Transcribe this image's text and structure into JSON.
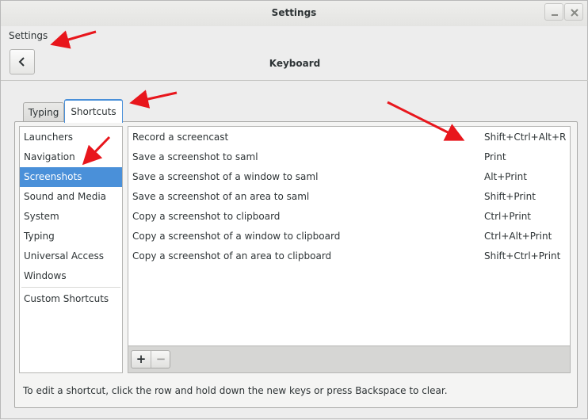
{
  "window": {
    "title": "Settings"
  },
  "header": {
    "breadcrumb": "Settings",
    "page_title": "Keyboard"
  },
  "tabs": [
    {
      "label": "Typing",
      "active": false
    },
    {
      "label": "Shortcuts",
      "active": true
    }
  ],
  "sidebar": {
    "items": [
      {
        "label": "Launchers",
        "selected": false
      },
      {
        "label": "Navigation",
        "selected": false
      },
      {
        "label": "Screenshots",
        "selected": true
      },
      {
        "label": "Sound and Media",
        "selected": false
      },
      {
        "label": "System",
        "selected": false
      },
      {
        "label": "Typing",
        "selected": false
      },
      {
        "label": "Universal Access",
        "selected": false
      },
      {
        "label": "Windows",
        "selected": false
      }
    ],
    "custom_item": "Custom Shortcuts"
  },
  "shortcuts": [
    {
      "action": "Record a screencast",
      "accel": "Shift+Ctrl+Alt+R"
    },
    {
      "action": "Save a screenshot to saml",
      "accel": "Print"
    },
    {
      "action": "Save a screenshot of a window to saml",
      "accel": "Alt+Print"
    },
    {
      "action": "Save a screenshot of an area to saml",
      "accel": "Shift+Print"
    },
    {
      "action": "Copy a screenshot to clipboard",
      "accel": "Ctrl+Print"
    },
    {
      "action": "Copy a screenshot of a window to clipboard",
      "accel": "Ctrl+Alt+Print"
    },
    {
      "action": "Copy a screenshot of an area to clipboard",
      "accel": "Shift+Ctrl+Print"
    }
  ],
  "toolbar": {
    "add_label": "+",
    "remove_label": "−"
  },
  "hint": "To edit a shortcut, click the row and hold down the new keys or press Backspace to clear.",
  "colors": {
    "selection": "#4a90d9",
    "annotation_arrow": "#e8161c"
  },
  "icons": {
    "back": "chevron-left-icon",
    "minimize": "minimize-icon",
    "close": "close-icon"
  }
}
